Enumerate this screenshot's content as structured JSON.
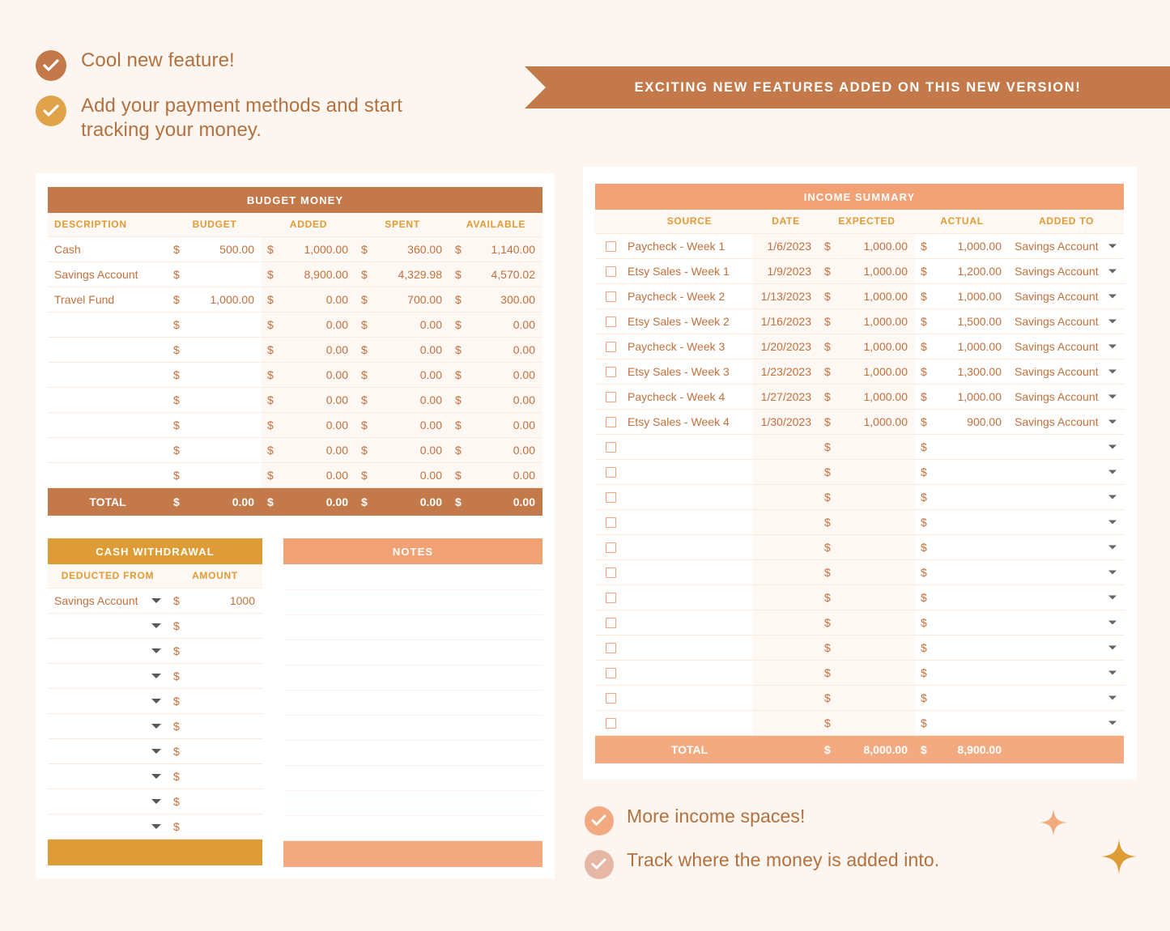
{
  "colors": {
    "page_bg": "#fdf6f0",
    "brown": "#c4794a",
    "gold": "#dd9c35",
    "peach": "#f1a274",
    "text_brown": "#b2713e",
    "value_orange": "#c2703c",
    "header_label": "#e29a33"
  },
  "features_top": [
    {
      "icon": "check-circle-icon",
      "color": "#c4794a",
      "text": "Cool new feature!"
    },
    {
      "icon": "check-circle-icon",
      "color": "#e0a34a",
      "text": "Add your payment methods and start tracking your money."
    }
  ],
  "ribbon": {
    "text": "EXCITING NEW FEATURES ADDED ON THIS NEW VERSION!"
  },
  "budget_money": {
    "title": "BUDGET MONEY",
    "columns": [
      "DESCRIPTION",
      "BUDGET",
      "ADDED",
      "SPENT",
      "AVAILABLE"
    ],
    "currency": "$",
    "rows": [
      {
        "description": "Cash",
        "budget": "500.00",
        "added": "1,000.00",
        "spent": "360.00",
        "available": "1,140.00"
      },
      {
        "description": "Savings Account",
        "budget": "",
        "added": "8,900.00",
        "spent": "4,329.98",
        "available": "4,570.02"
      },
      {
        "description": "Travel Fund",
        "budget": "1,000.00",
        "added": "0.00",
        "spent": "700.00",
        "available": "300.00"
      },
      {
        "description": "",
        "budget": "",
        "added": "0.00",
        "spent": "0.00",
        "available": "0.00"
      },
      {
        "description": "",
        "budget": "",
        "added": "0.00",
        "spent": "0.00",
        "available": "0.00"
      },
      {
        "description": "",
        "budget": "",
        "added": "0.00",
        "spent": "0.00",
        "available": "0.00"
      },
      {
        "description": "",
        "budget": "",
        "added": "0.00",
        "spent": "0.00",
        "available": "0.00"
      },
      {
        "description": "",
        "budget": "",
        "added": "0.00",
        "spent": "0.00",
        "available": "0.00"
      },
      {
        "description": "",
        "budget": "",
        "added": "0.00",
        "spent": "0.00",
        "available": "0.00"
      },
      {
        "description": "",
        "budget": "",
        "added": "0.00",
        "spent": "0.00",
        "available": "0.00"
      }
    ],
    "total": {
      "label": "TOTAL",
      "budget": "0.00",
      "added": "0.00",
      "spent": "0.00",
      "available": "0.00"
    }
  },
  "cash_withdrawal": {
    "title": "CASH WITHDRAWAL",
    "columns": [
      "DEDUCTED FROM",
      "AMOUNT"
    ],
    "currency": "$",
    "rows": [
      {
        "deducted_from": "Savings Account",
        "amount": "1000"
      },
      {
        "deducted_from": "",
        "amount": ""
      },
      {
        "deducted_from": "",
        "amount": ""
      },
      {
        "deducted_from": "",
        "amount": ""
      },
      {
        "deducted_from": "",
        "amount": ""
      },
      {
        "deducted_from": "",
        "amount": ""
      },
      {
        "deducted_from": "",
        "amount": ""
      },
      {
        "deducted_from": "",
        "amount": ""
      },
      {
        "deducted_from": "",
        "amount": ""
      },
      {
        "deducted_from": "",
        "amount": ""
      }
    ]
  },
  "notes": {
    "title": "NOTES",
    "lines": [
      "",
      "",
      "",
      "",
      "",
      "",
      "",
      "",
      "",
      "",
      ""
    ]
  },
  "income_summary": {
    "title": "INCOME SUMMARY",
    "columns": [
      "SOURCE",
      "DATE",
      "EXPECTED",
      "ACTUAL",
      "ADDED TO"
    ],
    "currency": "$",
    "rows": [
      {
        "checked": false,
        "source": "Paycheck - Week 1",
        "date": "1/6/2023",
        "expected": "1,000.00",
        "actual": "1,000.00",
        "added_to": "Savings Account"
      },
      {
        "checked": false,
        "source": "Etsy Sales - Week 1",
        "date": "1/9/2023",
        "expected": "1,000.00",
        "actual": "1,200.00",
        "added_to": "Savings Account"
      },
      {
        "checked": false,
        "source": "Paycheck - Week 2",
        "date": "1/13/2023",
        "expected": "1,000.00",
        "actual": "1,000.00",
        "added_to": "Savings Account"
      },
      {
        "checked": false,
        "source": "Etsy Sales - Week 2",
        "date": "1/16/2023",
        "expected": "1,000.00",
        "actual": "1,500.00",
        "added_to": "Savings Account"
      },
      {
        "checked": false,
        "source": "Paycheck - Week 3",
        "date": "1/20/2023",
        "expected": "1,000.00",
        "actual": "1,000.00",
        "added_to": "Savings Account"
      },
      {
        "checked": false,
        "source": "Etsy Sales - Week 3",
        "date": "1/23/2023",
        "expected": "1,000.00",
        "actual": "1,300.00",
        "added_to": "Savings Account"
      },
      {
        "checked": false,
        "source": "Paycheck - Week 4",
        "date": "1/27/2023",
        "expected": "1,000.00",
        "actual": "1,000.00",
        "added_to": "Savings Account"
      },
      {
        "checked": false,
        "source": "Etsy Sales - Week 4",
        "date": "1/30/2023",
        "expected": "1,000.00",
        "actual": "900.00",
        "added_to": "Savings Account"
      },
      {
        "checked": false,
        "source": "",
        "date": "",
        "expected": "",
        "actual": "",
        "added_to": ""
      },
      {
        "checked": false,
        "source": "",
        "date": "",
        "expected": "",
        "actual": "",
        "added_to": ""
      },
      {
        "checked": false,
        "source": "",
        "date": "",
        "expected": "",
        "actual": "",
        "added_to": ""
      },
      {
        "checked": false,
        "source": "",
        "date": "",
        "expected": "",
        "actual": "",
        "added_to": ""
      },
      {
        "checked": false,
        "source": "",
        "date": "",
        "expected": "",
        "actual": "",
        "added_to": ""
      },
      {
        "checked": false,
        "source": "",
        "date": "",
        "expected": "",
        "actual": "",
        "added_to": ""
      },
      {
        "checked": false,
        "source": "",
        "date": "",
        "expected": "",
        "actual": "",
        "added_to": ""
      },
      {
        "checked": false,
        "source": "",
        "date": "",
        "expected": "",
        "actual": "",
        "added_to": ""
      },
      {
        "checked": false,
        "source": "",
        "date": "",
        "expected": "",
        "actual": "",
        "added_to": ""
      },
      {
        "checked": false,
        "source": "",
        "date": "",
        "expected": "",
        "actual": "",
        "added_to": ""
      },
      {
        "checked": false,
        "source": "",
        "date": "",
        "expected": "",
        "actual": "",
        "added_to": ""
      },
      {
        "checked": false,
        "source": "",
        "date": "",
        "expected": "",
        "actual": "",
        "added_to": ""
      }
    ],
    "total": {
      "label": "TOTAL",
      "expected": "8,000.00",
      "actual": "8,900.00"
    }
  },
  "features_bottom": [
    {
      "icon": "check-circle-icon",
      "color": "#f3a97f",
      "text": "More income spaces!"
    },
    {
      "icon": "check-circle-icon",
      "color": "#e7b7a6",
      "text": "Track where the money is added into."
    }
  ],
  "sparkles": [
    {
      "name": "sparkle-small",
      "color": "#f5a97e"
    },
    {
      "name": "sparkle-large",
      "color": "#dd9c35"
    }
  ]
}
